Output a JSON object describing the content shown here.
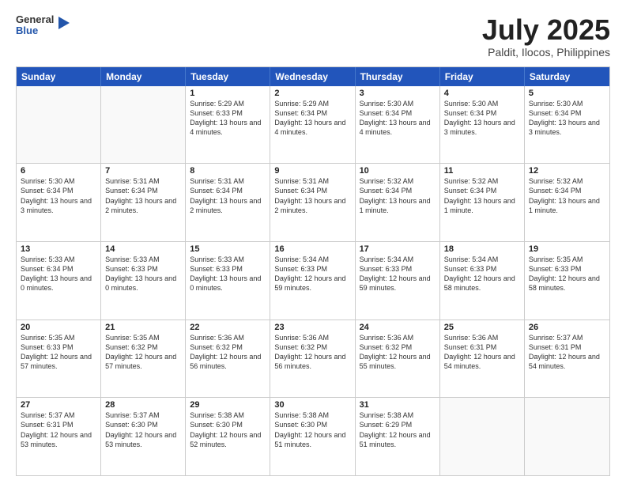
{
  "header": {
    "logo": {
      "general": "General",
      "blue": "Blue"
    },
    "title": "July 2025",
    "location": "Paldit, Ilocos, Philippines"
  },
  "calendar": {
    "days": [
      "Sunday",
      "Monday",
      "Tuesday",
      "Wednesday",
      "Thursday",
      "Friday",
      "Saturday"
    ],
    "rows": [
      [
        {
          "day": "",
          "info": ""
        },
        {
          "day": "",
          "info": ""
        },
        {
          "day": "1",
          "info": "Sunrise: 5:29 AM\nSunset: 6:33 PM\nDaylight: 13 hours and 4 minutes."
        },
        {
          "day": "2",
          "info": "Sunrise: 5:29 AM\nSunset: 6:34 PM\nDaylight: 13 hours and 4 minutes."
        },
        {
          "day": "3",
          "info": "Sunrise: 5:30 AM\nSunset: 6:34 PM\nDaylight: 13 hours and 4 minutes."
        },
        {
          "day": "4",
          "info": "Sunrise: 5:30 AM\nSunset: 6:34 PM\nDaylight: 13 hours and 3 minutes."
        },
        {
          "day": "5",
          "info": "Sunrise: 5:30 AM\nSunset: 6:34 PM\nDaylight: 13 hours and 3 minutes."
        }
      ],
      [
        {
          "day": "6",
          "info": "Sunrise: 5:30 AM\nSunset: 6:34 PM\nDaylight: 13 hours and 3 minutes."
        },
        {
          "day": "7",
          "info": "Sunrise: 5:31 AM\nSunset: 6:34 PM\nDaylight: 13 hours and 2 minutes."
        },
        {
          "day": "8",
          "info": "Sunrise: 5:31 AM\nSunset: 6:34 PM\nDaylight: 13 hours and 2 minutes."
        },
        {
          "day": "9",
          "info": "Sunrise: 5:31 AM\nSunset: 6:34 PM\nDaylight: 13 hours and 2 minutes."
        },
        {
          "day": "10",
          "info": "Sunrise: 5:32 AM\nSunset: 6:34 PM\nDaylight: 13 hours and 1 minute."
        },
        {
          "day": "11",
          "info": "Sunrise: 5:32 AM\nSunset: 6:34 PM\nDaylight: 13 hours and 1 minute."
        },
        {
          "day": "12",
          "info": "Sunrise: 5:32 AM\nSunset: 6:34 PM\nDaylight: 13 hours and 1 minute."
        }
      ],
      [
        {
          "day": "13",
          "info": "Sunrise: 5:33 AM\nSunset: 6:34 PM\nDaylight: 13 hours and 0 minutes."
        },
        {
          "day": "14",
          "info": "Sunrise: 5:33 AM\nSunset: 6:33 PM\nDaylight: 13 hours and 0 minutes."
        },
        {
          "day": "15",
          "info": "Sunrise: 5:33 AM\nSunset: 6:33 PM\nDaylight: 13 hours and 0 minutes."
        },
        {
          "day": "16",
          "info": "Sunrise: 5:34 AM\nSunset: 6:33 PM\nDaylight: 12 hours and 59 minutes."
        },
        {
          "day": "17",
          "info": "Sunrise: 5:34 AM\nSunset: 6:33 PM\nDaylight: 12 hours and 59 minutes."
        },
        {
          "day": "18",
          "info": "Sunrise: 5:34 AM\nSunset: 6:33 PM\nDaylight: 12 hours and 58 minutes."
        },
        {
          "day": "19",
          "info": "Sunrise: 5:35 AM\nSunset: 6:33 PM\nDaylight: 12 hours and 58 minutes."
        }
      ],
      [
        {
          "day": "20",
          "info": "Sunrise: 5:35 AM\nSunset: 6:33 PM\nDaylight: 12 hours and 57 minutes."
        },
        {
          "day": "21",
          "info": "Sunrise: 5:35 AM\nSunset: 6:32 PM\nDaylight: 12 hours and 57 minutes."
        },
        {
          "day": "22",
          "info": "Sunrise: 5:36 AM\nSunset: 6:32 PM\nDaylight: 12 hours and 56 minutes."
        },
        {
          "day": "23",
          "info": "Sunrise: 5:36 AM\nSunset: 6:32 PM\nDaylight: 12 hours and 56 minutes."
        },
        {
          "day": "24",
          "info": "Sunrise: 5:36 AM\nSunset: 6:32 PM\nDaylight: 12 hours and 55 minutes."
        },
        {
          "day": "25",
          "info": "Sunrise: 5:36 AM\nSunset: 6:31 PM\nDaylight: 12 hours and 54 minutes."
        },
        {
          "day": "26",
          "info": "Sunrise: 5:37 AM\nSunset: 6:31 PM\nDaylight: 12 hours and 54 minutes."
        }
      ],
      [
        {
          "day": "27",
          "info": "Sunrise: 5:37 AM\nSunset: 6:31 PM\nDaylight: 12 hours and 53 minutes."
        },
        {
          "day": "28",
          "info": "Sunrise: 5:37 AM\nSunset: 6:30 PM\nDaylight: 12 hours and 53 minutes."
        },
        {
          "day": "29",
          "info": "Sunrise: 5:38 AM\nSunset: 6:30 PM\nDaylight: 12 hours and 52 minutes."
        },
        {
          "day": "30",
          "info": "Sunrise: 5:38 AM\nSunset: 6:30 PM\nDaylight: 12 hours and 51 minutes."
        },
        {
          "day": "31",
          "info": "Sunrise: 5:38 AM\nSunset: 6:29 PM\nDaylight: 12 hours and 51 minutes."
        },
        {
          "day": "",
          "info": ""
        },
        {
          "day": "",
          "info": ""
        }
      ]
    ]
  }
}
